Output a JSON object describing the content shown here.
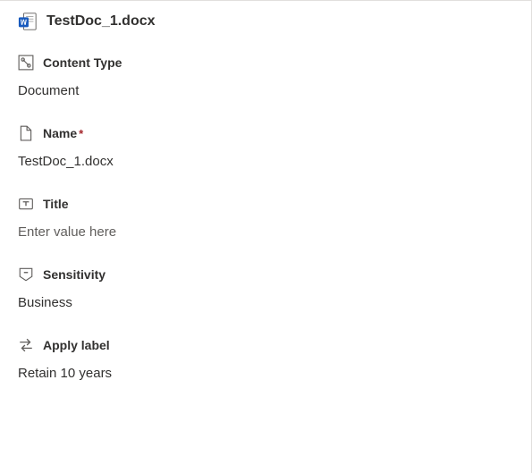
{
  "header": {
    "filename": "TestDoc_1.docx"
  },
  "fields": {
    "contentType": {
      "label": "Content Type",
      "value": "Document"
    },
    "name": {
      "label": "Name",
      "required": "*",
      "value": "TestDoc_1.docx"
    },
    "title": {
      "label": "Title",
      "placeholder": "Enter value here"
    },
    "sensitivity": {
      "label": "Sensitivity",
      "value": "Business"
    },
    "applyLabel": {
      "label": "Apply label",
      "value": "Retain 10 years"
    }
  }
}
